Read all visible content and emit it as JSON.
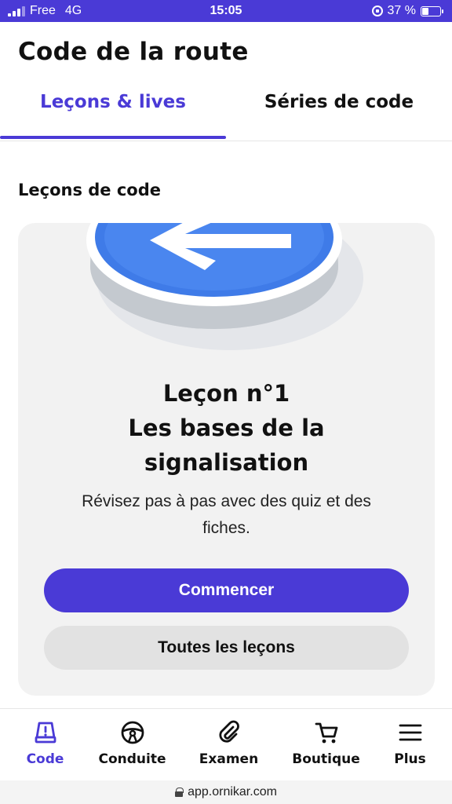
{
  "status_bar": {
    "carrier": "Free",
    "network": "4G",
    "time": "15:05",
    "battery": "37 %",
    "battery_level": 0.37
  },
  "header": {
    "title": "Code de la route"
  },
  "tabs": [
    {
      "label": "Leçons & lives",
      "active": true
    },
    {
      "label": "Séries de code",
      "active": false
    }
  ],
  "section": {
    "title": "Leçons de code"
  },
  "lesson_card": {
    "title_line1": "Leçon n°1",
    "title_line2": "Les bases de la",
    "title_line3": "signalisation",
    "description": "Révisez pas à pas avec des quiz et des fiches.",
    "start_button": "Commencer",
    "all_button": "Toutes les leçons",
    "illustration": "blue-left-arrow-road-sign"
  },
  "bottom_nav": [
    {
      "label": "Code",
      "icon": "code-warning-icon",
      "active": true
    },
    {
      "label": "Conduite",
      "icon": "steering-wheel-icon",
      "active": false
    },
    {
      "label": "Examen",
      "icon": "paperclip-icon",
      "active": false
    },
    {
      "label": "Boutique",
      "icon": "cart-icon",
      "active": false
    },
    {
      "label": "Plus",
      "icon": "menu-icon",
      "active": false
    }
  ],
  "url_bar": {
    "url": "app.ornikar.com"
  },
  "colors": {
    "accent": "#4a3ad6",
    "sign_blue": "#3f7be8",
    "card_bg": "#f2f2f2"
  }
}
